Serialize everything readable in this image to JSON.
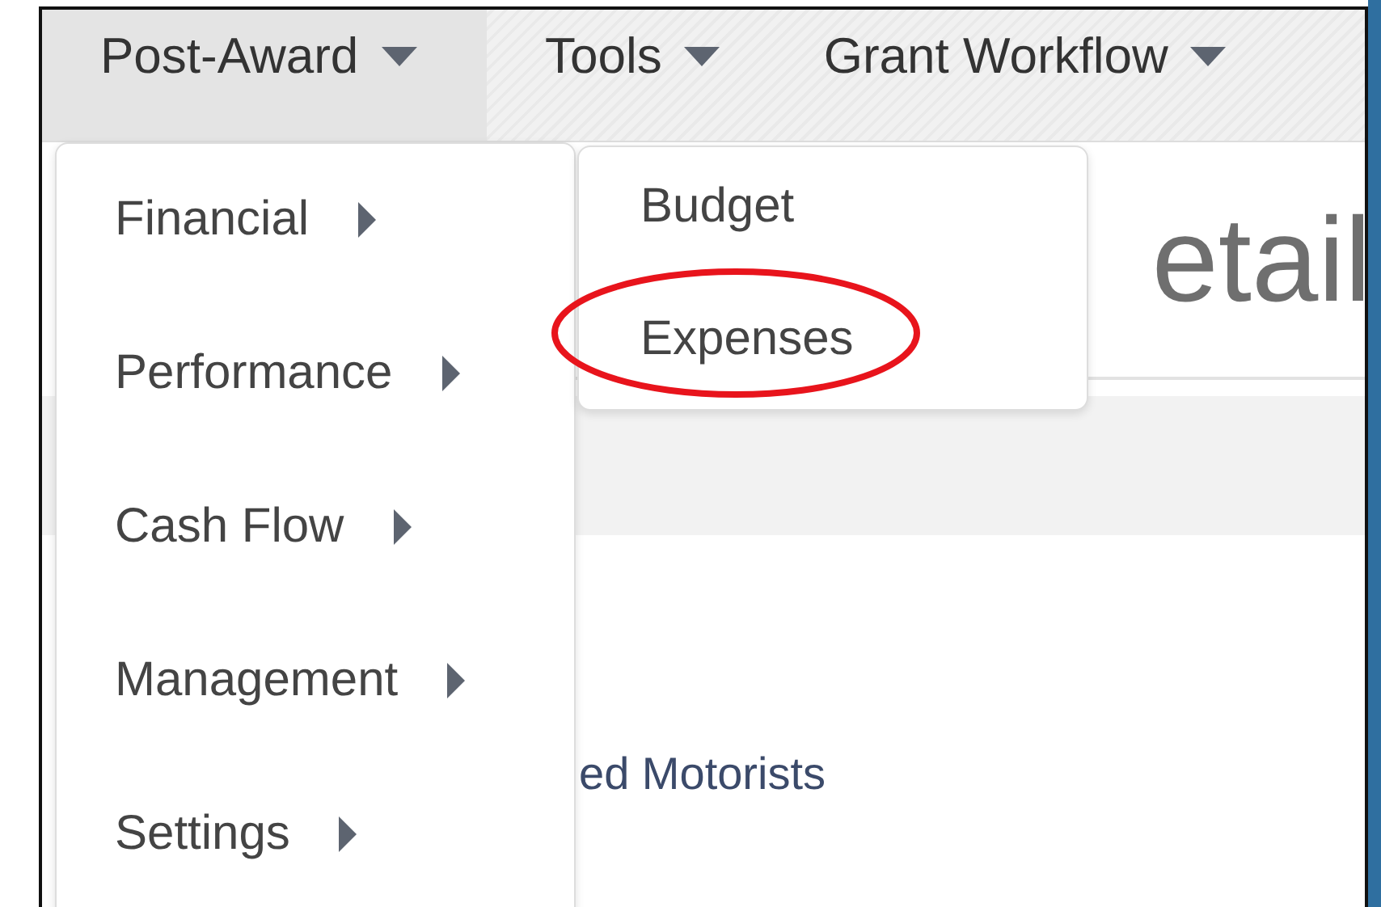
{
  "nav": [
    {
      "label": "Post-Award",
      "selected": true
    },
    {
      "label": "Tools",
      "selected": false
    },
    {
      "label": "Grant Workflow",
      "selected": false
    }
  ],
  "menu": [
    {
      "label": "Financial"
    },
    {
      "label": "Performance"
    },
    {
      "label": "Cash Flow"
    },
    {
      "label": "Management"
    },
    {
      "label": "Settings"
    }
  ],
  "submenu": [
    {
      "label": "Budget",
      "circled": false
    },
    {
      "label": "Expenses",
      "circled": true
    }
  ],
  "page": {
    "heading": "etail",
    "name": "ed Motorists"
  }
}
